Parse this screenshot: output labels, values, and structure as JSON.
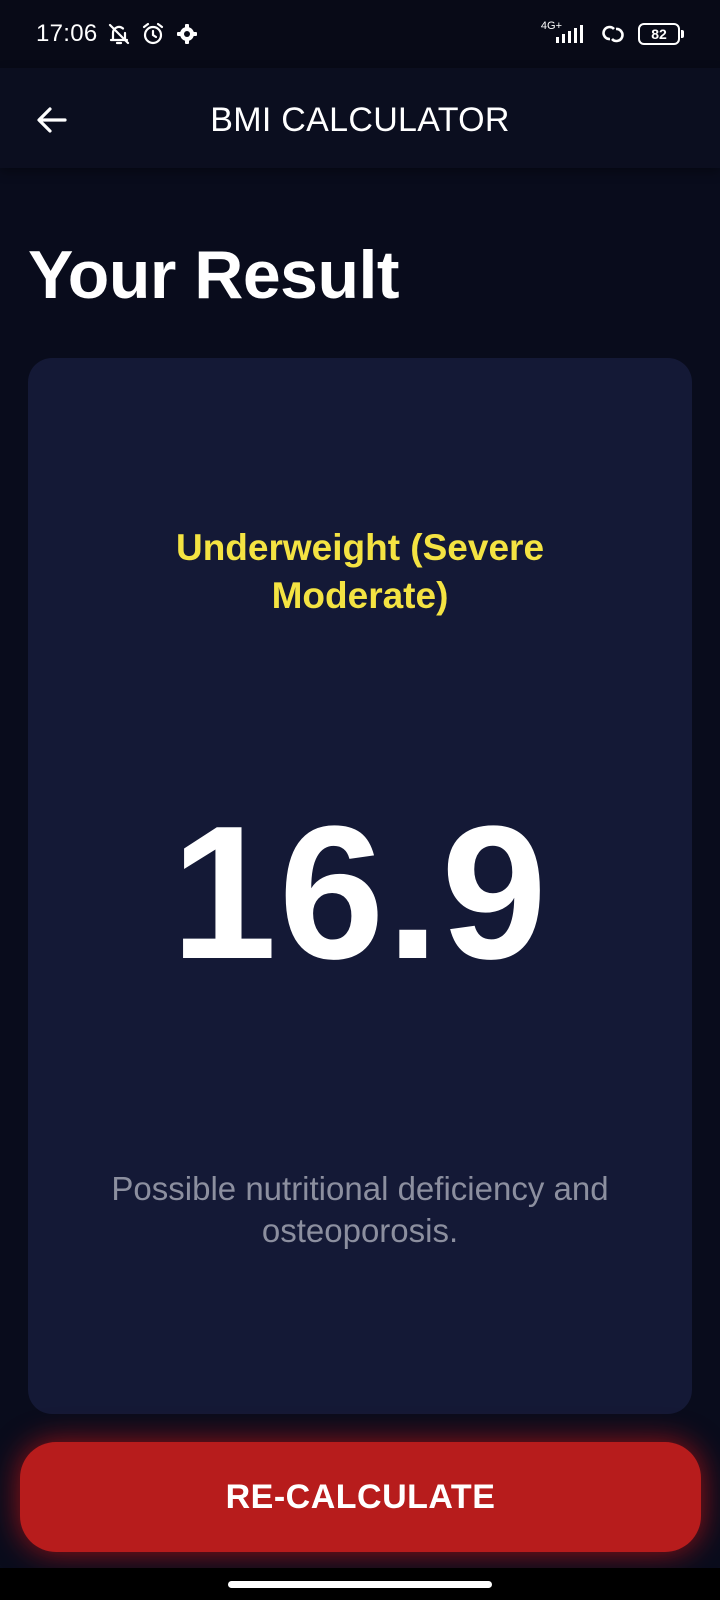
{
  "status_bar": {
    "time": "17:06",
    "icons": [
      "bell-off-icon",
      "alarm-icon",
      "gear-icon"
    ],
    "network_label": "4G+",
    "battery_level": "82"
  },
  "app_bar": {
    "title": "BMI CALCULATOR",
    "back_icon": "arrow-left-icon"
  },
  "page": {
    "title": "Your Result"
  },
  "result": {
    "category": "Underweight (Severe Moderate)",
    "bmi": "16.9",
    "advice": "Possible nutritional deficiency and osteoporosis."
  },
  "actions": {
    "recalculate_label": "RE-CALCULATE"
  },
  "colors": {
    "background": "#090c1c",
    "card": "#141936",
    "category_text": "#f4e342",
    "button": "#b71c1c",
    "muted_text": "#8c8f9f"
  }
}
